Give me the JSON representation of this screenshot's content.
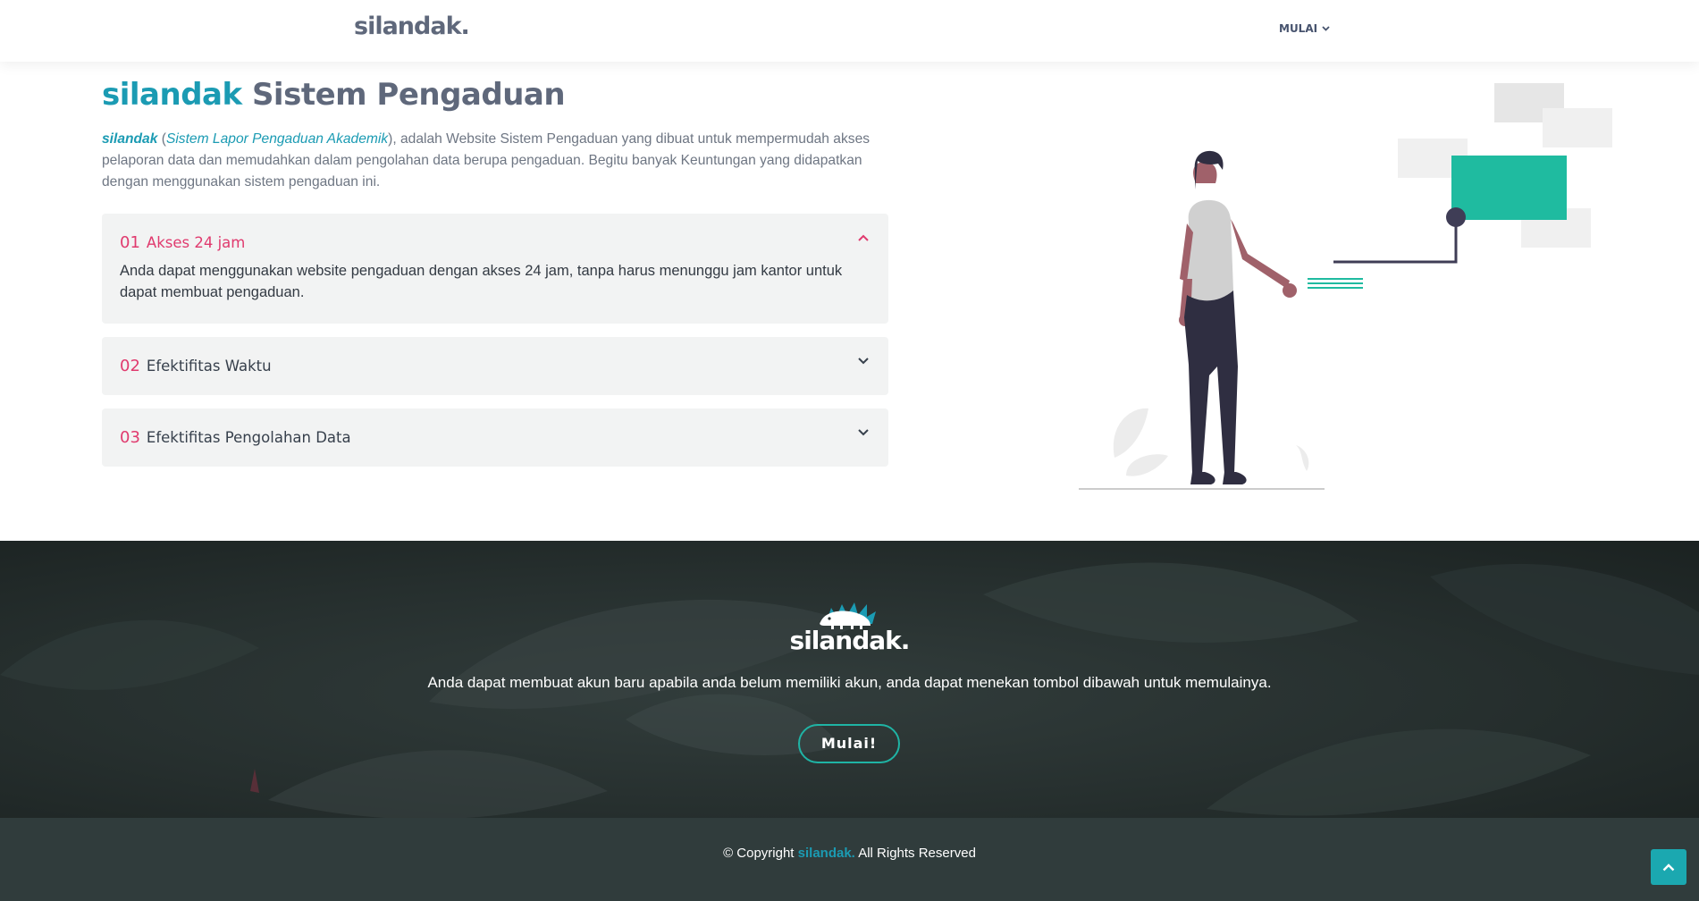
{
  "header": {
    "logo": "silandak.",
    "nav_label": "MULAI"
  },
  "about": {
    "title_brand": "silandak",
    "title_rest": "Sistem Pengaduan",
    "intro_brand": "silandak",
    "intro_open": " (",
    "intro_full": "Sistem Lapor Pengaduan Akademik",
    "intro_rest": "), adalah Website Sistem Pengaduan yang dibuat untuk mempermudah akses pelaporan data dan memudahkan dalam pengolahan data berupa pengaduan. Begitu banyak Keuntungan yang didapatkan dengan menggunakan sistem pengaduan ini."
  },
  "faq": [
    {
      "num": "01",
      "label": "Akses 24 jam",
      "body": "Anda dapat menggunakan website pengaduan dengan akses 24 jam, tanpa harus menunggu jam kantor untuk dapat membuat pengaduan."
    },
    {
      "num": "02",
      "label": "Efektifitas Waktu"
    },
    {
      "num": "03",
      "label": "Efektifitas Pengolahan Data"
    }
  ],
  "cta": {
    "logo": "silandak.",
    "text": "Anda dapat membuat akun baru apabila anda belum memiliki akun, anda dapat menekan tombol dibawah untuk memulainya.",
    "button": "Mulai!"
  },
  "footer": {
    "prefix": "© Copyright ",
    "brand": "silandak.",
    "suffix": " All Rights Reserved"
  },
  "colors": {
    "accent": "#1b9bb3",
    "faq_accent": "#e03a6e",
    "teal": "#1fb4a5",
    "footer_bg": "#303c3c"
  },
  "icons": [
    "chevron-down-icon",
    "chevron-up-icon",
    "hedgehog-logo-icon",
    "arrow-up-icon"
  ]
}
